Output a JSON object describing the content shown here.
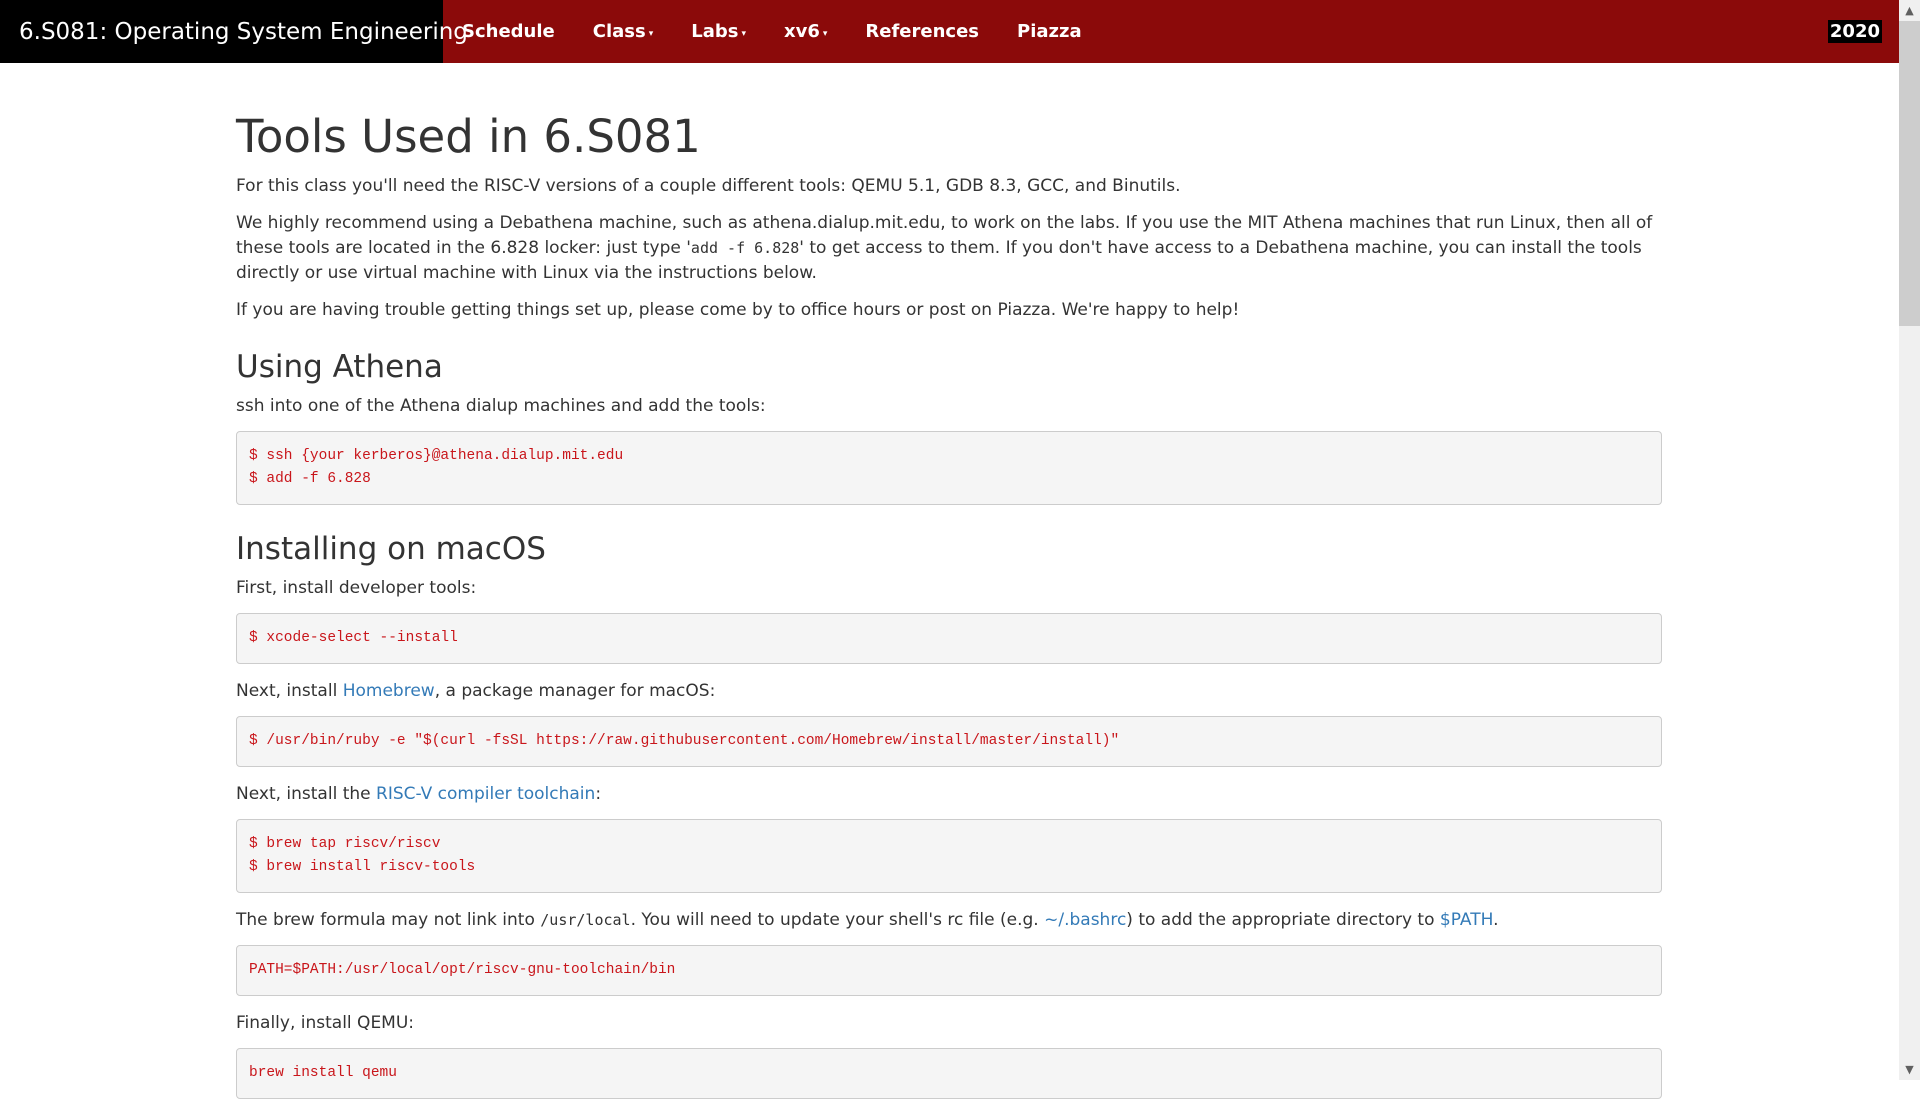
{
  "navbar": {
    "brand": "6.S081: Operating System Engineering",
    "items": [
      {
        "label": "Schedule",
        "dropdown": false
      },
      {
        "label": "Class",
        "dropdown": true
      },
      {
        "label": "Labs",
        "dropdown": true
      },
      {
        "label": "xv6",
        "dropdown": true
      },
      {
        "label": "References",
        "dropdown": false
      },
      {
        "label": "Piazza",
        "dropdown": false
      }
    ],
    "caret_glyph": "▾",
    "year": "2020"
  },
  "colors": {
    "navbar_bg": "#8b0a0a",
    "brand_bg": "#000000",
    "link": "#337ab7",
    "code_text": "#c9161b",
    "code_bg": "#f5f5f5"
  },
  "page": {
    "title": "Tools Used in 6.S081",
    "intro1": "For this class you'll need the RISC-V versions of a couple different tools: QEMU 5.1, GDB 8.3, GCC, and Binutils.",
    "intro2_a": "We highly recommend using a Debathena machine, such as athena.dialup.mit.edu, to work on the labs. If you use the MIT Athena machines that run Linux, then all of these tools are located in the 6.828 locker: just type '",
    "intro2_code": "add -f 6.828",
    "intro2_b": "' to get access to them. If you don't have access to a Debathena machine, you can install the tools directly or use virtual machine with Linux via the instructions below.",
    "intro3": "If you are having trouble getting things set up, please come by to office hours or post on Piazza. We're happy to help!",
    "athena": {
      "heading": "Using Athena",
      "text": "ssh into one of the Athena dialup machines and add the tools:",
      "code": "$ ssh {your kerberos}@athena.dialup.mit.edu\n$ add -f 6.828"
    },
    "macos": {
      "heading": "Installing on macOS",
      "step1_text": "First, install developer tools:",
      "step1_code": "$ xcode-select --install",
      "step2_pre": "Next, install ",
      "step2_link": "Homebrew",
      "step2_post": ", a package manager for macOS:",
      "step2_code": "$ /usr/bin/ruby -e \"$(curl -fsSL https://raw.githubusercontent.com/Homebrew/install/master/install)\"",
      "step3_pre": "Next, install the ",
      "step3_link": "RISC-V compiler toolchain",
      "step3_post": ":",
      "step3_code": "$ brew tap riscv/riscv\n$ brew install riscv-tools",
      "step4_a": "The brew formula may not link into ",
      "step4_code": "/usr/local",
      "step4_b": ". You will need to update your shell's rc file (e.g. ",
      "step4_link1": "~/.bashrc",
      "step4_c": ") to add the appropriate directory to ",
      "step4_link2": "$PATH",
      "step4_d": ".",
      "step4_codebox": "PATH=$PATH:/usr/local/opt/riscv-gnu-toolchain/bin",
      "step5_text": "Finally, install QEMU:",
      "step5_code": "brew install qemu"
    }
  },
  "scrollbar": {
    "up_glyph": "▲",
    "down_glyph": "▼",
    "scroll_position_fraction": 0.0
  }
}
